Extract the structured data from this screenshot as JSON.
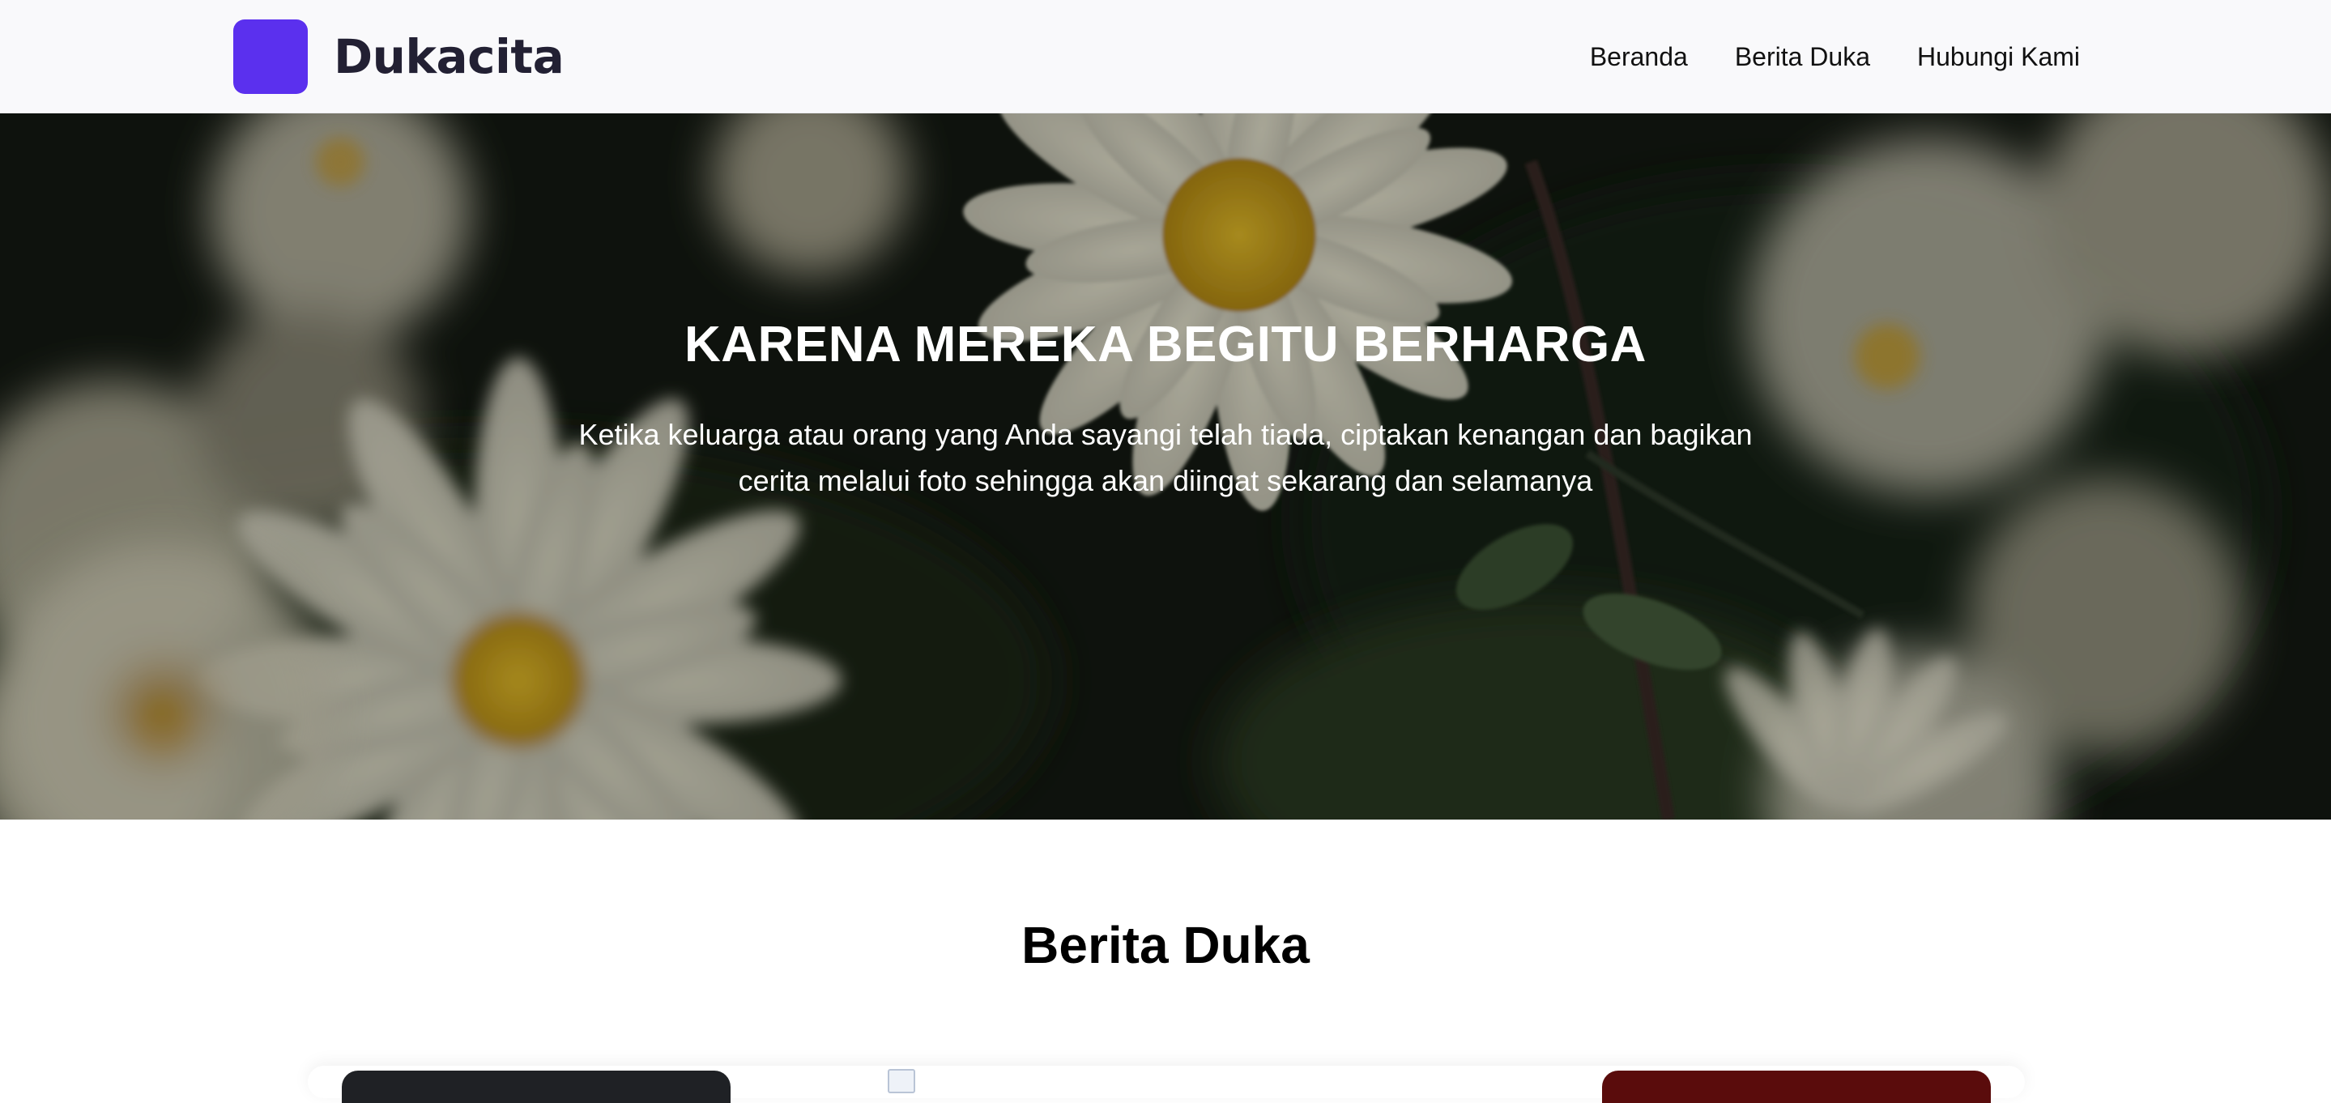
{
  "brand": {
    "name": "Dukacita",
    "logo_color": "#5b30ee"
  },
  "nav": {
    "items": [
      {
        "label": "Beranda"
      },
      {
        "label": "Berita Duka"
      },
      {
        "label": "Hubungi Kami"
      }
    ]
  },
  "hero": {
    "title": "KARENA MEREKA BEGITU BERHARGA",
    "subtitle": "Ketika keluarga atau orang yang Anda sayangi telah tiada, ciptakan kenangan dan bagikan cerita melalui foto sehingga akan diingat sekarang dan selamanya",
    "background": "white-chrysanthemum-flowers"
  },
  "section": {
    "title": "Berita Duka"
  },
  "cards": [
    {
      "accent": "#1f2125"
    },
    {
      "image": "broken-image-icon"
    },
    {
      "accent": "#5a0c0c"
    }
  ]
}
